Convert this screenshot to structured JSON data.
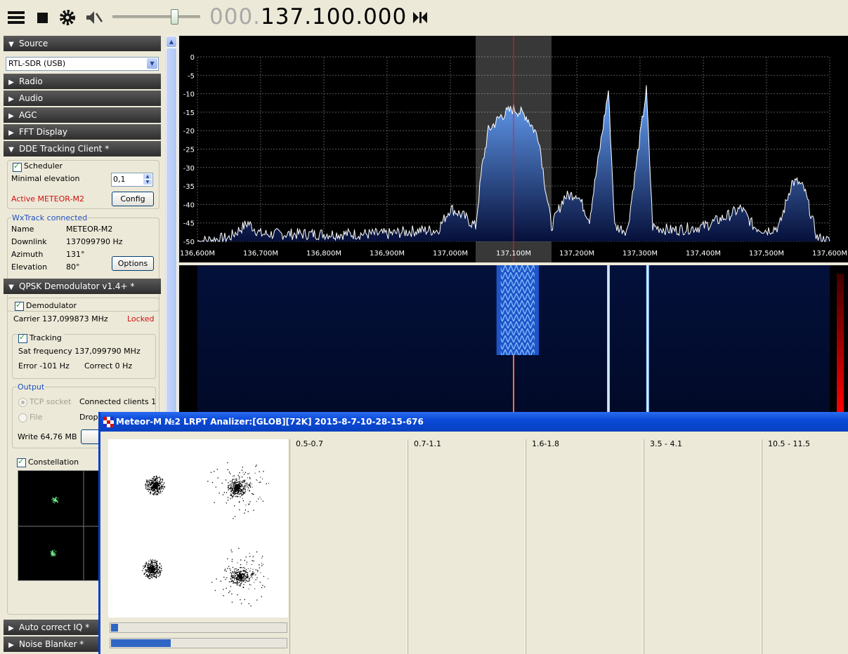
{
  "toolbar": {
    "icons": [
      "menu-icon",
      "stop-icon",
      "gear-icon",
      "mute-icon",
      "skip-icon"
    ],
    "volume": 0.7,
    "frequency_dim": "000.",
    "frequency_main": "137.100.000"
  },
  "sections": {
    "source": "Source",
    "radio": "Radio",
    "audio": "Audio",
    "agc": "AGC",
    "fft": "FFT Display",
    "dde": "DDE Tracking Client *",
    "qpsk": "QPSK Demodulator v1.4+ *",
    "autoiq": "Auto correct IQ *",
    "noise": "Noise Blanker *"
  },
  "source": {
    "device": "RTL-SDR (USB)"
  },
  "dde": {
    "scheduler_label": "Scheduler",
    "min_elev_label": "Minimal elevation",
    "min_elev_value": "0,1",
    "active_label": "Active METEOR-M2",
    "config_button": "Config",
    "wxtrack": "WxTrack connected",
    "name_label": "Name",
    "name_value": "METEOR-M2",
    "downlink_label": "Downlink",
    "downlink_value": "137099790 Hz",
    "azimuth_label": "Azimuth",
    "azimuth_value": "131°",
    "elevation_label": "Elevation",
    "elevation_value": "80°",
    "options_button": "Options"
  },
  "qpsk": {
    "demod_label": "Demodulator",
    "carrier": "Carrier 137,099873 MHz",
    "locked": "Locked",
    "tracking_label": "Tracking",
    "sat_freq": "Sat frequency 137,099790 MHz",
    "error": "Error -101 Hz",
    "correct": "Correct 0 Hz",
    "output_label": "Output",
    "tcp_label": "TCP socket",
    "clients": "Connected clients 1",
    "file_label": "File",
    "dropped": "Dropp",
    "write": "Write 64,76 MB",
    "constellation_label": "Constellation"
  },
  "chart_data": {
    "type": "line",
    "title": "",
    "xlabel": "",
    "ylabel": "",
    "ylim": [
      -50,
      0
    ],
    "xlim": [
      136.6,
      137.6
    ],
    "yticks": [
      "0",
      "-5",
      "-10",
      "-15",
      "-20",
      "-25",
      "-30",
      "-35",
      "-40",
      "-45",
      "-50"
    ],
    "xticks": [
      "136,600M",
      "136,700M",
      "136,800M",
      "136,900M",
      "137,000M",
      "137,100M",
      "137,200M",
      "137,300M",
      "137,400M",
      "137,500M",
      "137,600M"
    ],
    "filter_band": [
      137.04,
      137.16
    ],
    "center": 137.1,
    "x": [
      136.6,
      136.65,
      136.68,
      136.7,
      136.75,
      136.8,
      136.85,
      136.9,
      136.95,
      136.98,
      137.0,
      137.02,
      137.04,
      137.05,
      137.06,
      137.08,
      137.1,
      137.12,
      137.14,
      137.15,
      137.16,
      137.18,
      137.2,
      137.22,
      137.25,
      137.26,
      137.28,
      137.31,
      137.32,
      137.35,
      137.4,
      137.44,
      137.46,
      137.48,
      137.5,
      137.52,
      137.54,
      137.55,
      137.56,
      137.58,
      137.6
    ],
    "y": [
      -50,
      -49,
      -45,
      -48,
      -48,
      -48,
      -48,
      -48,
      -47,
      -47,
      -41,
      -43,
      -46,
      -30,
      -20,
      -16,
      -14,
      -16,
      -22,
      -35,
      -46,
      -38,
      -37,
      -44,
      -9,
      -46,
      -47,
      -9,
      -46,
      -47,
      -46,
      -43,
      -41,
      -46,
      -47,
      -46,
      -34,
      -34,
      -36,
      -49,
      -50
    ]
  },
  "analyzer": {
    "title": "Meteor-M №2 LRPT Analizer:[GLOB][72K] 2015-8-7-10-28-15-676",
    "bar1": 0.04,
    "bar2": 0.34,
    "columns": [
      "0.5-0.7",
      "0.7-1.1",
      "1.6-1.8",
      "3.5 - 4.1",
      "10.5 - 11.5"
    ]
  }
}
